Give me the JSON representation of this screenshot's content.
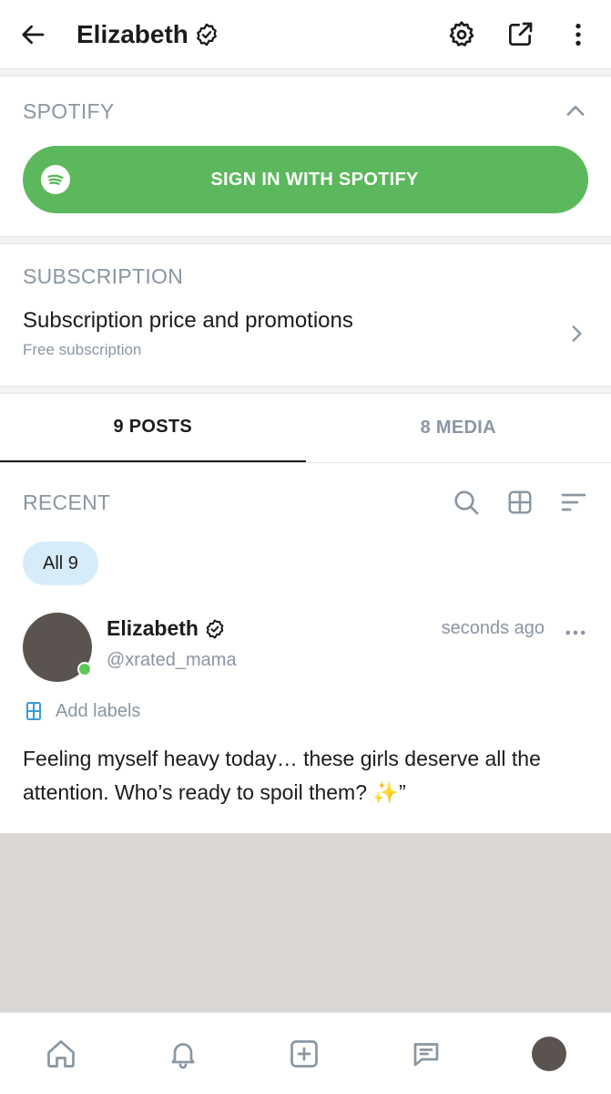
{
  "header": {
    "title": "Elizabeth"
  },
  "spotify": {
    "section_label": "SPOTIFY",
    "button_label": "SIGN IN WITH SPOTIFY"
  },
  "subscription": {
    "section_label": "SUBSCRIPTION",
    "title": "Subscription price and promotions",
    "subtitle": "Free subscription"
  },
  "tabs": [
    {
      "label": "9 POSTS",
      "active": true
    },
    {
      "label": "8 MEDIA",
      "active": false
    }
  ],
  "feed": {
    "section_label": "RECENT",
    "filter_chip": "All 9"
  },
  "post": {
    "author_name": "Elizabeth",
    "author_handle": "@xrated_mama",
    "time": "seconds ago",
    "labels_action": "Add labels",
    "text": "Feeling myself heavy today… these girls deserve all the attention. Who’s ready to spoil them? ✨”"
  },
  "icons": {
    "back": "arrow-left-icon",
    "verified": "verified-badge-icon",
    "settings": "gear-icon",
    "share": "share-icon",
    "more": "more-vertical-icon",
    "collapse": "chevron-up-icon",
    "spotify": "spotify-icon",
    "arrow": "chevron-right-icon",
    "search": "search-icon",
    "grid": "grid-icon",
    "sort": "sort-icon",
    "labels": "label-icon",
    "post_more": "more-horizontal-icon",
    "nav_home": "home-icon",
    "nav_notifications": "bell-icon",
    "nav_create": "plus-square-icon",
    "nav_messages": "message-icon"
  },
  "colors": {
    "spotify_green": "#5cb85c",
    "muted_text": "#8a96a3",
    "chip_bg": "#d6ecfa",
    "online": "#5cc85c",
    "accent_blue": "#3a9bd8"
  }
}
